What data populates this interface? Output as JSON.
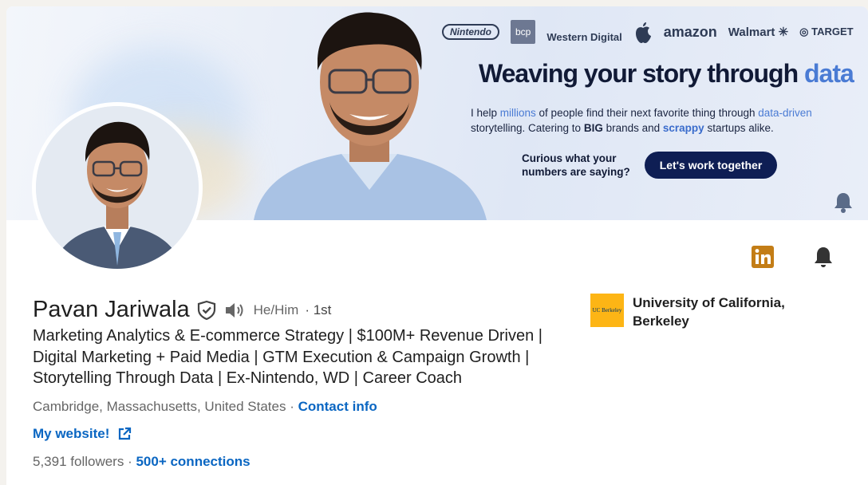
{
  "banner": {
    "logos": [
      "Nintendo",
      "bcp",
      "Western Digital",
      "apple-logo-icon",
      "amazon",
      "Walmart",
      "TARGET"
    ],
    "headline_start": "Weaving your story through ",
    "headline_highlight": "data",
    "desc_1": "I help ",
    "desc_millions": "millions",
    "desc_2": " of people find their next favorite thing through ",
    "desc_data_driven": "data-driven",
    "desc_3": " storytelling. Catering to ",
    "desc_big": "BIG",
    "desc_4": " brands and ",
    "desc_scrappy": "scrappy",
    "desc_5": " startups alike.",
    "curious_text": "Curious what your numbers are saying?",
    "cta_label": "Let's work together"
  },
  "profile": {
    "name": "Pavan Jariwala",
    "pronouns": "He/Him",
    "degree": "· 1st",
    "headline": "Marketing Analytics & E-commerce Strategy | $100M+ Revenue Driven | Digital Marketing + Paid Media | GTM Execution & Campaign Growth | Storytelling Through Data | Ex-Nintendo, WD | Career Coach",
    "location": "Cambridge, Massachusetts, United States",
    "separator": " · ",
    "contact_info_label": "Contact info",
    "website_label": "My website!",
    "followers": "5,391 followers",
    "stats_separator": " · ",
    "connections": "500+ connections"
  },
  "education": {
    "logo_text": "UC Berkeley",
    "name": "University of California, Berkeley"
  },
  "colors": {
    "link": "#0a66c2",
    "linkedin_icon": "#c37d16",
    "cta_bg": "#0e1e54",
    "berkeley_gold": "#fdb515"
  }
}
